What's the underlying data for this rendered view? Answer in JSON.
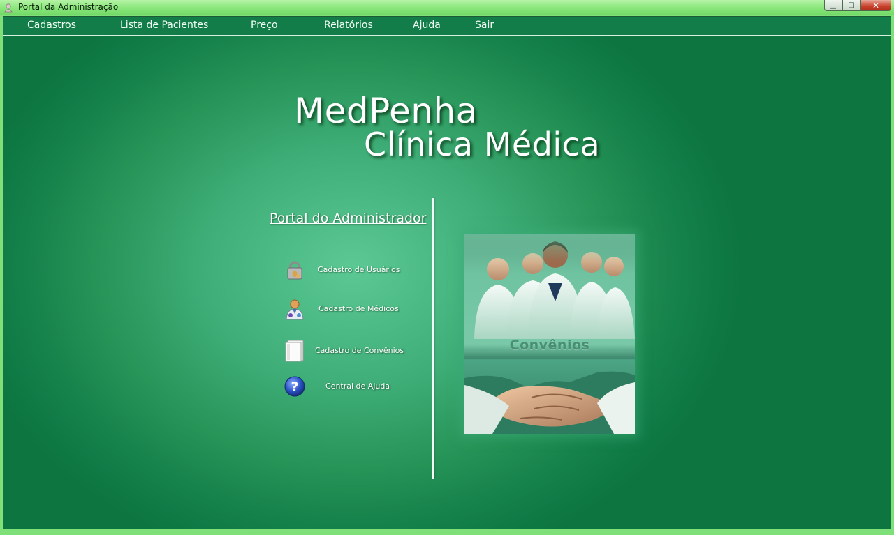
{
  "window": {
    "title": "Portal da Administração",
    "buttons": {
      "minimize": "▁",
      "maximize": "□",
      "close": "✕"
    }
  },
  "menu": {
    "items": [
      {
        "label": "Cadastros"
      },
      {
        "label": "Lista de Pacientes"
      },
      {
        "label": "Preço"
      },
      {
        "label": "Relatórios"
      },
      {
        "label": "Ajuda"
      },
      {
        "label": "Sair"
      }
    ]
  },
  "brand": {
    "line1": "MedPenha",
    "line2": "Clínica Médica"
  },
  "portal": {
    "title": "Portal do Administrador",
    "actions": [
      {
        "label": "Cadastro de Usuários",
        "icon": "padlock-user-icon"
      },
      {
        "label": "Cadastro de Médicos",
        "icon": "doctor-icon"
      },
      {
        "label": "Cadastro de Convênios",
        "icon": "document-icon"
      },
      {
        "label": "Central de Ajuda",
        "icon": "help-icon"
      }
    ]
  },
  "banner": {
    "label": "Convênios"
  },
  "colors": {
    "menubar": "#137d49",
    "accent_green": "#279558",
    "titlebar_green": "#8fe980"
  }
}
